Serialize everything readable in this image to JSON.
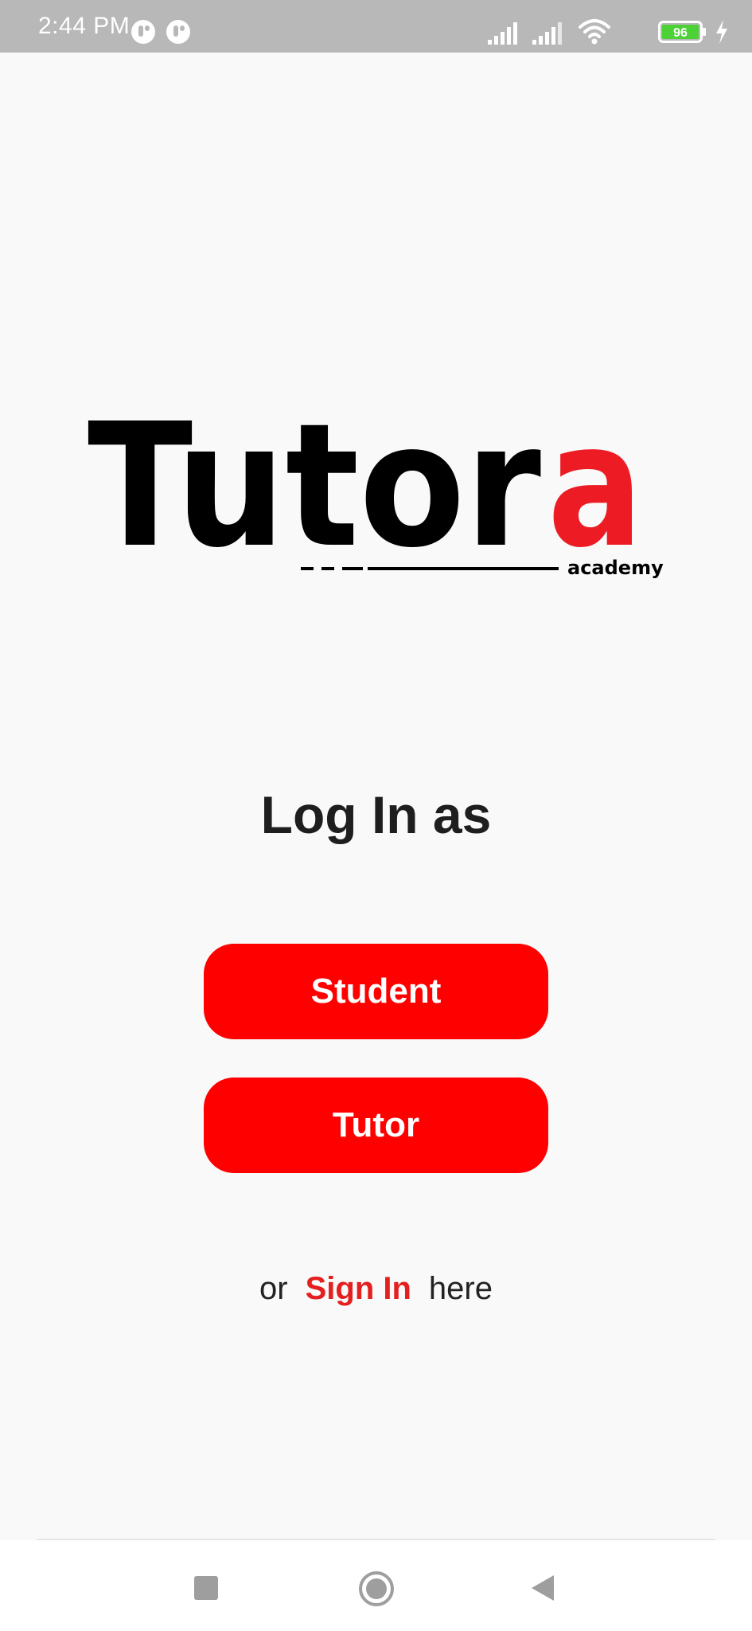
{
  "status_bar": {
    "time": "2:44 PM",
    "battery_level": "96",
    "icons": [
      "app-notification-icon",
      "app-notification-icon",
      "signal-icon",
      "signal-icon",
      "wifi-icon",
      "battery-icon",
      "charging-icon"
    ]
  },
  "logo": {
    "text_main": "Tutor",
    "text_accent": "a",
    "subtext": "academy",
    "colors": {
      "main": "#000000",
      "accent": "#ed1c24"
    }
  },
  "main": {
    "heading": "Log In as",
    "student_label": "Student",
    "tutor_label": "Tutor",
    "signin_prefix": "or",
    "signin_link": "Sign In",
    "signin_suffix": "here"
  },
  "colors": {
    "button_bg": "#ff0000",
    "link": "#e41f1f",
    "background": "#f9f9f9",
    "status_bar": "#b8b8b8"
  },
  "nav_bar": {
    "icons": [
      "recent-apps-icon",
      "home-icon",
      "back-icon"
    ]
  }
}
